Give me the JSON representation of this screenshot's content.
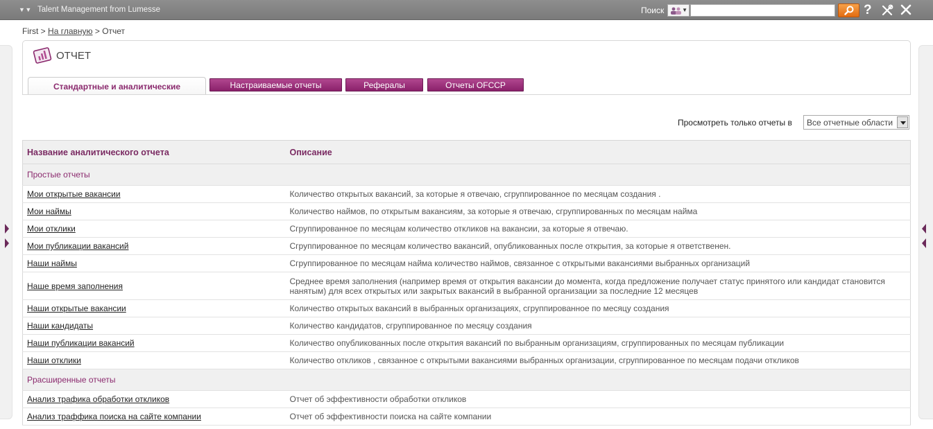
{
  "topbar": {
    "app_title": "Talent Management from Lumesse",
    "search_label": "Поиск",
    "search_value": "",
    "help_glyph": "?"
  },
  "icons": [
    "menu-arrows-icon",
    "people-icon",
    "search-icon",
    "help-icon",
    "tools-icon",
    "close-icon",
    "report-icon",
    "expand-left-icon",
    "collapse-right-icon"
  ],
  "breadcrumb": {
    "first": "First",
    "sep1": ">",
    "home": "На главную",
    "sep2": ">",
    "current": "Отчет"
  },
  "page": {
    "title": "ОТЧЕТ"
  },
  "tabs": [
    {
      "label": "Стандартные и аналитические",
      "active": true
    },
    {
      "label": "Настраиваемые отчеты",
      "active": false
    },
    {
      "label": "Рефералы",
      "active": false
    },
    {
      "label": "Отчеты OFCCP",
      "active": false
    }
  ],
  "filter": {
    "label": "Просмотреть только отчеты в",
    "selected": "Все отчетные области"
  },
  "table": {
    "headers": {
      "name": "Название аналитического отчета",
      "description": "Описание"
    },
    "groups": [
      {
        "title": "Простые отчеты",
        "rows": [
          {
            "name": "Мои открытые вакансии",
            "description": "Количество открытых вакансий, за которые я отвечаю, сгруппированное по месяцам создания ."
          },
          {
            "name": "Мои наймы",
            "description": "Количество наймов, по открытым вакансиям, за которые я отвечаю, сгруппированных по месяцам найма"
          },
          {
            "name": "Мои отклики",
            "description": "Сгруппированное по месяцам количество откликов на вакансии, за которые я отвечаю."
          },
          {
            "name": "Мои публикации вакансий",
            "description": "Сгруппированное по месяцам количество вакансий, опубликованных после открытия, за которые я ответственен."
          },
          {
            "name": "Наши наймы",
            "description": "Сгруппированное по месяцам найма количество наймов, связанное с открытыми вакансиями выбранных организаций"
          },
          {
            "name": "Наше время заполнения",
            "description": "Среднее время заполнения (например время от открытия вакансии до момента, когда предложение получает статус принятого или кандидат становится нанятым) для всех открытых или закрытых вакансий в выбранной организации за последние 12 месяцев"
          },
          {
            "name": "Наши открытые вакансии",
            "description": "Количество открытых вакансий в выбранных организациях, сгруппированное по месяцу создания"
          },
          {
            "name": "Наши кандидаты",
            "description": "Количество кандидатов, сгруппированное по месяцу создания"
          },
          {
            "name": "Наши публикации вакансий",
            "description": "Количество опубликованных после открытия вакансий по выбранным организациям, сгруппированных по месяцам публикации"
          },
          {
            "name": "Наши отклики",
            "description": "Количество откликов , связанное с открытыми вакансиями выбранных организации, сгруппированное по месяцам подачи откликов"
          }
        ]
      },
      {
        "title": "Ррасширенные отчеты",
        "rows": [
          {
            "name": "Анализ трафика обработки откликов",
            "description": "Отчет об эффективности обработки откликов"
          },
          {
            "name": "Анализ траффика поиска на сайте компании",
            "description": "Отчет об эффективности поиска на сайте компании"
          }
        ]
      }
    ]
  }
}
